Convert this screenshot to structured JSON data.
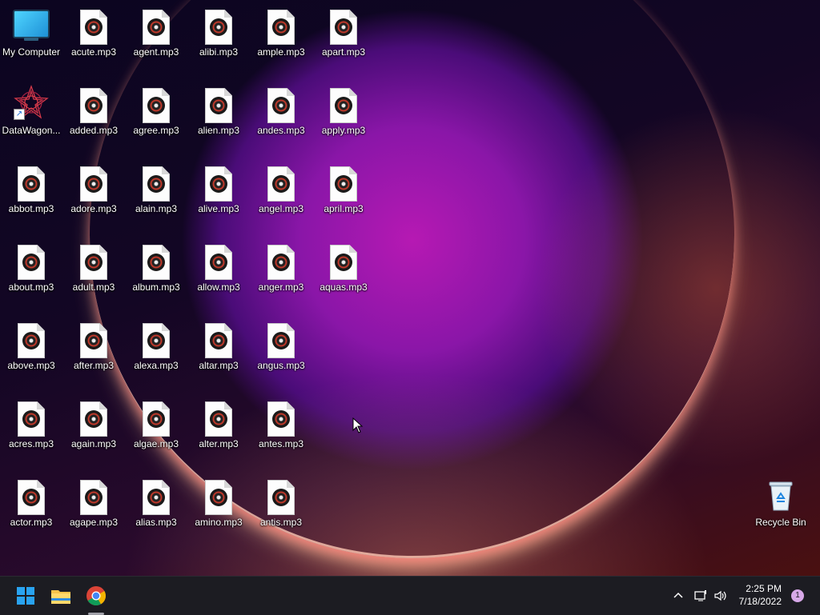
{
  "desktop": {
    "my_computer": "My Computer",
    "datawagon": "DataWagon...",
    "recycle_bin": "Recycle Bin",
    "columns": [
      [
        "acute.mp3",
        "added.mp3",
        "adore.mp3",
        "adult.mp3",
        "after.mp3",
        "again.mp3",
        "agape.mp3"
      ],
      [
        "agent.mp3",
        "agree.mp3",
        "alain.mp3",
        "album.mp3",
        "alexa.mp3",
        "algae.mp3",
        "alias.mp3"
      ],
      [
        "alibi.mp3",
        "alien.mp3",
        "alive.mp3",
        "allow.mp3",
        "altar.mp3",
        "alter.mp3",
        "amino.mp3"
      ],
      [
        "ample.mp3",
        "andes.mp3",
        "angel.mp3",
        "anger.mp3",
        "angus.mp3",
        "antes.mp3",
        "antis.mp3"
      ],
      [
        "apart.mp3",
        "apply.mp3",
        "april.mp3",
        "aquas.mp3"
      ]
    ],
    "first_column": [
      "abbot.mp3",
      "about.mp3",
      "above.mp3",
      "acres.mp3",
      "actor.mp3"
    ]
  },
  "taskbar": {
    "time": "2:25 PM",
    "date": "7/18/2022",
    "notifications": "1",
    "icons": [
      "windows-start-icon",
      "file-explorer-icon",
      "chrome-icon"
    ],
    "tray": [
      "chevron-up-icon",
      "network-icon",
      "volume-icon"
    ]
  },
  "colors": {
    "taskbar": "#1c1c22",
    "accent": "#0078d4"
  }
}
